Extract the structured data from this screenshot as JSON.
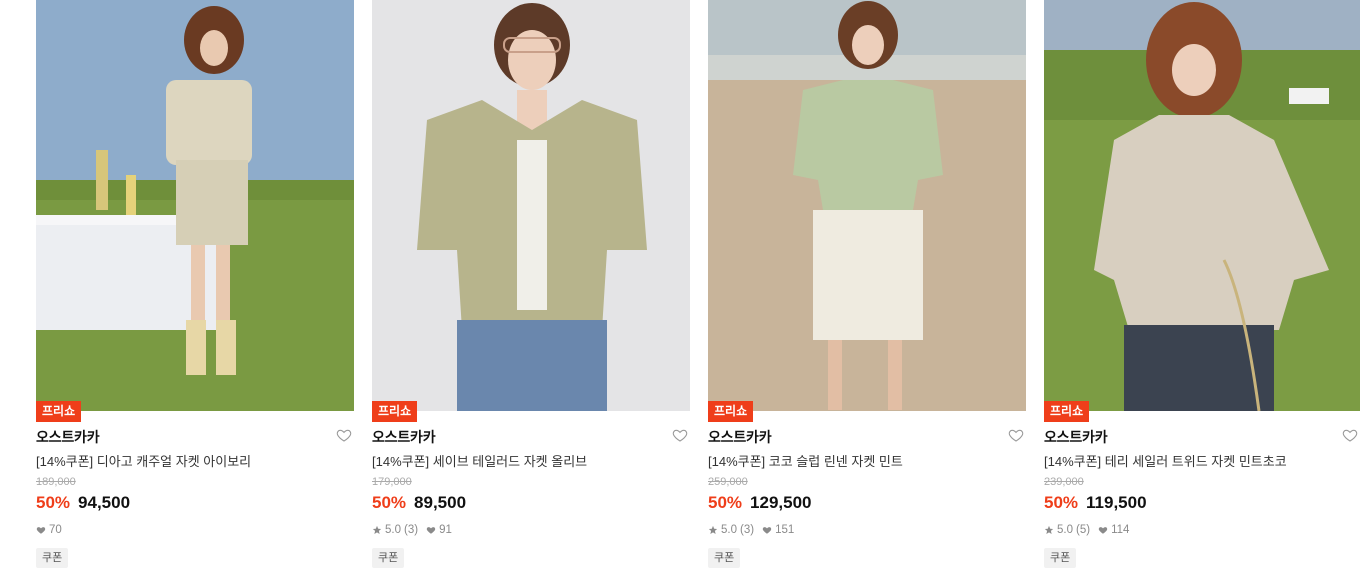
{
  "products": [
    {
      "badge": "프리쇼",
      "brand": "오스트카카",
      "name": "[14%쿠폰] 디아고 캐주얼 자켓 아이보리",
      "original_price": "189,000",
      "discount": "50%",
      "price": "94,500",
      "rating": "",
      "review_count": "",
      "likes": "70",
      "coupon_label": "쿠폰",
      "photo_desc": "model in ivory jacket and skirt on grassy field beside white table",
      "garment_color": "#ddd6bf"
    },
    {
      "badge": "프리쇼",
      "brand": "오스트카카",
      "name": "[14%쿠폰] 세이브 테일러드 자켓 올리브",
      "original_price": "179,000",
      "discount": "50%",
      "price": "89,500",
      "rating": "5.0",
      "review_count": "(3)",
      "likes": "91",
      "coupon_label": "쿠폰",
      "photo_desc": "model in olive tailored jacket and jeans on grey studio background",
      "garment_color": "#b7b48c"
    },
    {
      "badge": "프리쇼",
      "brand": "오스트카카",
      "name": "[14%쿠폰] 코코 슬럽 린넨 자켓 민트",
      "original_price": "259,000",
      "discount": "50%",
      "price": "129,500",
      "rating": "5.0",
      "review_count": "(3)",
      "likes": "151",
      "coupon_label": "쿠폰",
      "photo_desc": "model in mint linen jacket and white shorts on sandy beach",
      "garment_color": "#b9c9a2"
    },
    {
      "badge": "프리쇼",
      "brand": "오스트카카",
      "name": "[14%쿠폰] 테리 세일러 트위드 자켓 민트초코",
      "original_price": "239,000",
      "discount": "50%",
      "price": "119,500",
      "rating": "5.0",
      "review_count": "(5)",
      "likes": "114",
      "coupon_label": "쿠폰",
      "photo_desc": "model in tweed sailor jacket holding a bag on grassy hill",
      "garment_color": "#d8cfc0"
    }
  ],
  "icons": {
    "wishlist": "heart-outline-icon",
    "likes": "heart-icon",
    "rating": "star-icon"
  },
  "colors": {
    "accent": "#ef3e1a",
    "badge_text": "#ffffff",
    "muted": "#8a8a8a"
  }
}
